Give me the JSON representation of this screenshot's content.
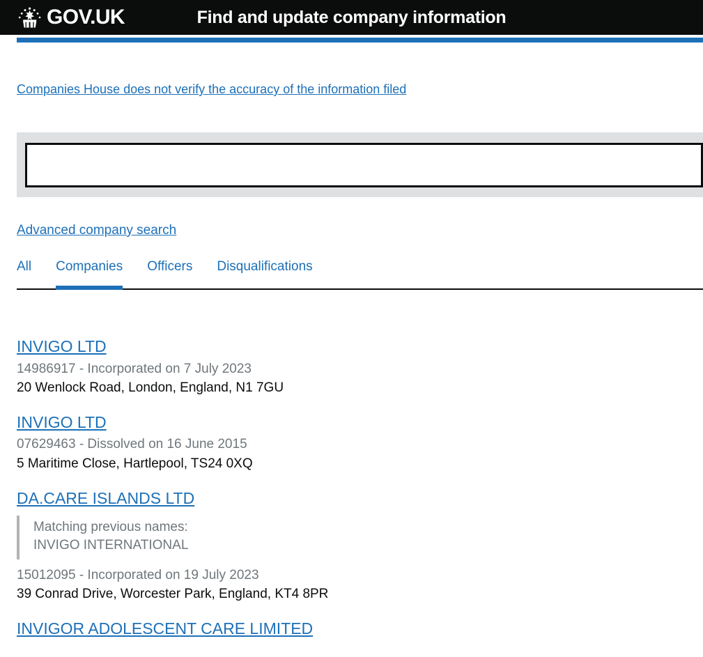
{
  "header": {
    "logo_text": "GOV.UK",
    "crown_icon": "crown-icon",
    "service_name": "Find and update company information"
  },
  "disclaimer": {
    "text": "Companies House does not verify the accuracy of the information filed"
  },
  "search": {
    "value": "",
    "placeholder": ""
  },
  "advanced_search": {
    "label": "Advanced company search"
  },
  "tabs": [
    {
      "label": "All",
      "active": false
    },
    {
      "label": "Companies",
      "active": true
    },
    {
      "label": "Officers",
      "active": false
    },
    {
      "label": "Disqualifications",
      "active": false
    }
  ],
  "results": [
    {
      "title": "INVIGO LTD",
      "meta": "14986917 - Incorporated on 7 July 2023",
      "address": "20 Wenlock Road, London, England, N1 7GU"
    },
    {
      "title": "INVIGO LTD",
      "meta": "07629463 - Dissolved on 16 June 2015",
      "address": "5 Maritime Close, Hartlepool, TS24 0XQ"
    },
    {
      "title": "DA.CARE ISLANDS LTD",
      "previous_names_label": "Matching previous names:",
      "previous_names": "INVIGO INTERNATIONAL",
      "meta": "15012095 - Incorporated on 19 July 2023",
      "address": "39 Conrad Drive, Worcester Park, England, KT4 8PR"
    },
    {
      "title": "INVIGOR ADOLESCENT CARE LIMITED",
      "meta": "",
      "address": ""
    }
  ],
  "colors": {
    "govuk_black": "#0b0c0c",
    "govuk_blue": "#1d70b8",
    "grey_text": "#6f777b",
    "grey_panel": "#dee0e2",
    "grey_border": "#b1b4b6"
  }
}
